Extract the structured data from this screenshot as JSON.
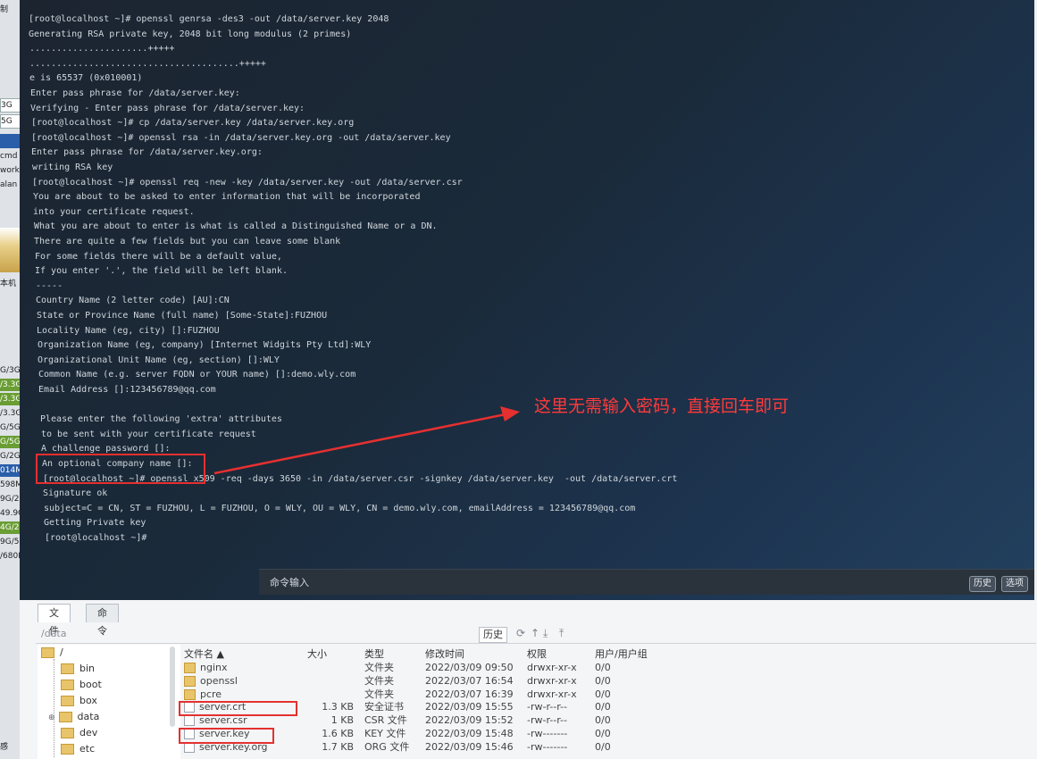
{
  "left_strip": {
    "items": [
      "制",
      "3G",
      "5G",
      "cmd",
      "work",
      "alan",
      "本机",
      "G/3G",
      "/3.3G",
      "/3.3G",
      "/3.3G",
      "G/5G",
      "G/5G",
      "G/2G",
      "014M",
      "598M",
      "9G/2G",
      "49.9G",
      "4G/2G",
      "9G/5G",
      "/680M",
      "感"
    ]
  },
  "terminal": {
    "lines": [
      "[root@localhost ~]# openssl genrsa -des3 -out /data/server.key 2048",
      "Generating RSA private key, 2048 bit long modulus (2 primes)",
      "......................+++++",
      ".......................................+++++",
      "e is 65537 (0x010001)",
      "Enter pass phrase for /data/server.key:",
      "Verifying - Enter pass phrase for /data/server.key:",
      "[root@localhost ~]# cp /data/server.key /data/server.key.org",
      "[root@localhost ~]# openssl rsa -in /data/server.key.org -out /data/server.key",
      "Enter pass phrase for /data/server.key.org:",
      "writing RSA key",
      "[root@localhost ~]# openssl req -new -key /data/server.key -out /data/server.csr",
      "You are about to be asked to enter information that will be incorporated",
      "into your certificate request.",
      "What you are about to enter is what is called a Distinguished Name or a DN.",
      "There are quite a few fields but you can leave some blank",
      "For some fields there will be a default value,",
      "If you enter '.', the field will be left blank.",
      "-----",
      "Country Name (2 letter code) [AU]:CN",
      "State or Province Name (full name) [Some-State]:FUZHOU",
      "Locality Name (eg, city) []:FUZHOU",
      "Organization Name (eg, company) [Internet Widgits Pty Ltd]:WLY",
      "Organizational Unit Name (eg, section) []:WLY",
      "Common Name (e.g. server FQDN or YOUR name) []:demo.wly.com",
      "Email Address []:123456789@qq.com",
      "",
      "Please enter the following 'extra' attributes",
      "to be sent with your certificate request",
      "A challenge password []:",
      "An optional company name []:",
      "[root@localhost ~]# openssl x509 -req -days 3650 -in /data/server.csr -signkey /data/server.key  -out /data/server.crt",
      "Signature ok",
      "subject=C = CN, ST = FUZHOU, L = FUZHOU, O = WLY, OU = WLY, CN = demo.wly.com, emailAddress = 123456789@qq.com",
      "Getting Private key",
      "[root@localhost ~]#"
    ],
    "annotation": "这里无需输入密码，直接回车即可",
    "cmd_label": "命令输入",
    "history_btn": "历史",
    "options_btn": "选项"
  },
  "file_panel": {
    "tab_files": "文件",
    "tab_commands": "命令",
    "path": "/data",
    "history_btn": "历史",
    "tree": {
      "root": "/",
      "items": [
        "bin",
        "boot",
        "box",
        "data",
        "dev",
        "etc"
      ]
    },
    "columns": {
      "name": "文件名 ▲",
      "size": "大小",
      "type": "类型",
      "modified": "修改时间",
      "perm": "权限",
      "owner": "用户/用户组"
    },
    "rows": [
      {
        "name": "nginx",
        "size": "",
        "type": "文件夹",
        "modified": "2022/03/09 09:50",
        "perm": "drwxr-xr-x",
        "owner": "0/0",
        "dir": true
      },
      {
        "name": "openssl",
        "size": "",
        "type": "文件夹",
        "modified": "2022/03/07 16:54",
        "perm": "drwxr-xr-x",
        "owner": "0/0",
        "dir": true
      },
      {
        "name": "pcre",
        "size": "",
        "type": "文件夹",
        "modified": "2022/03/07 16:39",
        "perm": "drwxr-xr-x",
        "owner": "0/0",
        "dir": true
      },
      {
        "name": "server.crt",
        "size": "1.3 KB",
        "type": "安全证书",
        "modified": "2022/03/09 15:55",
        "perm": "-rw-r--r--",
        "owner": "0/0",
        "dir": false
      },
      {
        "name": "server.csr",
        "size": "1 KB",
        "type": "CSR 文件",
        "modified": "2022/03/09 15:52",
        "perm": "-rw-r--r--",
        "owner": "0/0",
        "dir": false
      },
      {
        "name": "server.key",
        "size": "1.6 KB",
        "type": "KEY 文件",
        "modified": "2022/03/09 15:48",
        "perm": "-rw-------",
        "owner": "0/0",
        "dir": false
      },
      {
        "name": "server.key.org",
        "size": "1.7 KB",
        "type": "ORG 文件",
        "modified": "2022/03/09 15:46",
        "perm": "-rw-------",
        "owner": "0/0",
        "dir": false
      }
    ]
  },
  "colors": {
    "annotation_red": "#ff3a3a",
    "terminal_text": "#cfd6dc"
  }
}
